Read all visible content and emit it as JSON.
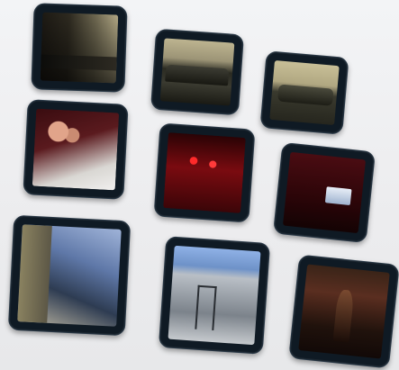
{
  "gallery": {
    "tiles": [
      {
        "icon": "office-photo-thumbnail"
      },
      {
        "icon": "sofa-photo-thumbnail"
      },
      {
        "icon": "sofa-photo-thumbnail"
      },
      {
        "icon": "people-at-desk-photo-thumbnail"
      },
      {
        "icon": "red-lit-stage-photo-thumbnail"
      },
      {
        "icon": "laptop-in-red-room-photo-thumbnail"
      },
      {
        "icon": "glass-window-photo-thumbnail"
      },
      {
        "icon": "building-facade-photo-thumbnail"
      },
      {
        "icon": "dark-interior-photo-thumbnail"
      }
    ],
    "colors": {
      "background": "#ececee",
      "frame": "#0f1a24",
      "frame_border": "#2b3a48"
    }
  }
}
